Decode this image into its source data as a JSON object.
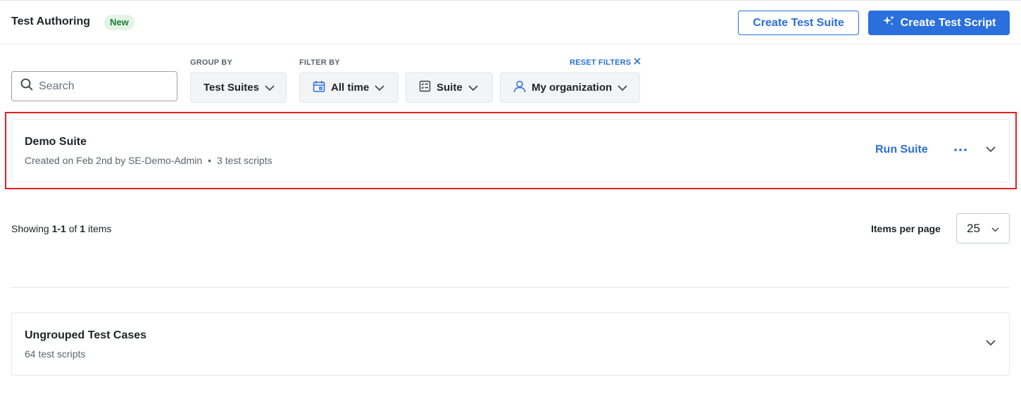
{
  "header": {
    "title": "Test Authoring",
    "badge": "New",
    "create_suite_label": "Create Test Suite",
    "create_script_label": "Create Test Script"
  },
  "filters": {
    "search_placeholder": "Search",
    "group_by_label": "GROUP BY",
    "group_by_value": "Test Suites",
    "filter_by_label": "FILTER BY",
    "time_value": "All time",
    "type_value": "Suite",
    "org_value": "My organization",
    "reset_label": "RESET FILTERS"
  },
  "suites": [
    {
      "name": "Demo Suite",
      "created": "Created on Feb 2nd by SE-Demo-Admin",
      "scripts": "3 test scripts",
      "run_label": "Run Suite"
    }
  ],
  "pagination": {
    "showing_prefix": "Showing",
    "range": "1-1",
    "of_word": "of",
    "total": "1",
    "items_word": "items",
    "per_page_label": "Items per page",
    "per_page_value": "25"
  },
  "ungrouped": {
    "title": "Ungrouped Test Cases",
    "count": "64 test scripts"
  },
  "colors": {
    "accent": "#2a6fdb",
    "highlight": "#e8201e",
    "badge_bg": "#e3f4e6",
    "badge_text": "#1e7d35"
  }
}
